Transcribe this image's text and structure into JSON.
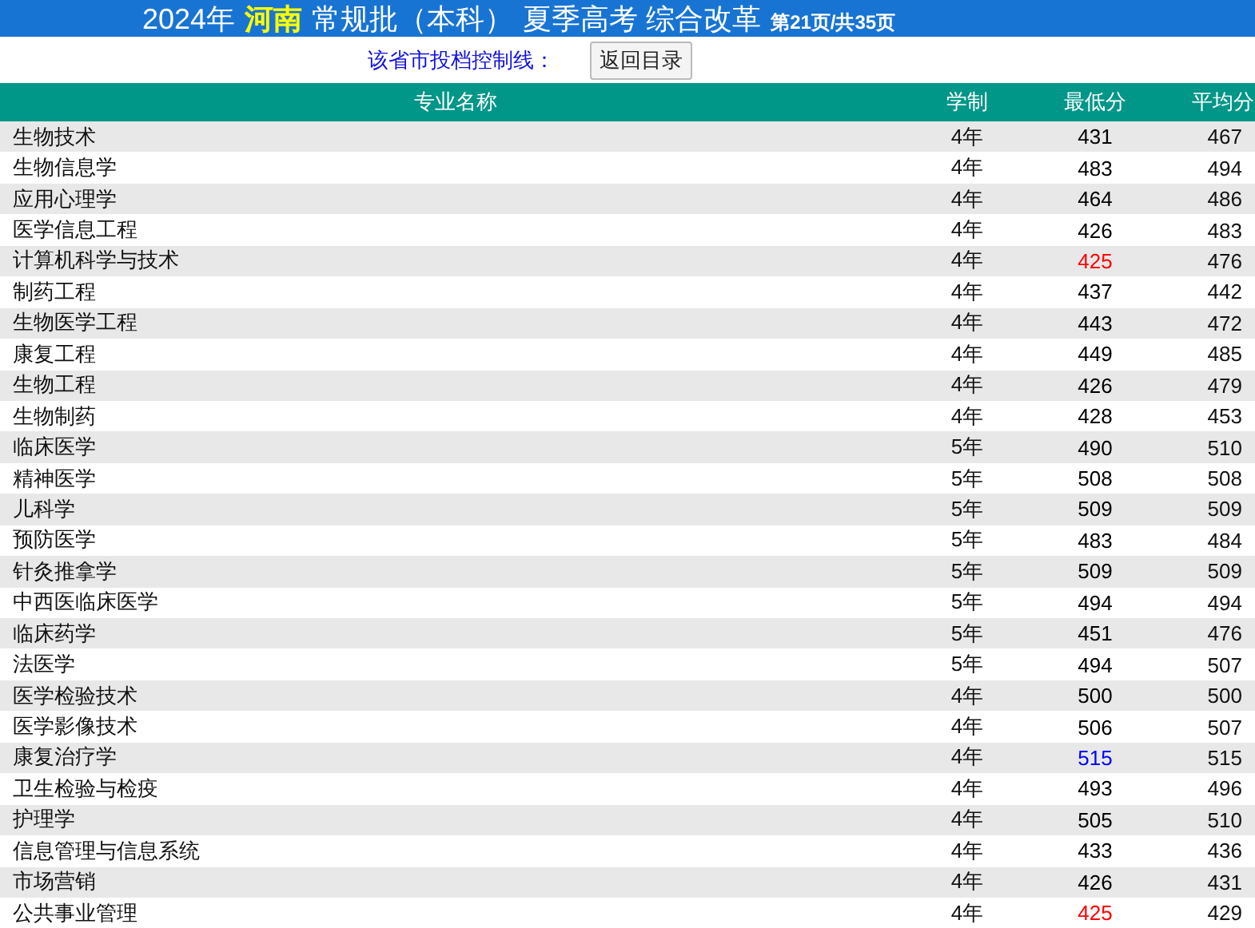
{
  "title": {
    "year": "2024年",
    "province": "河南",
    "batch": "常规批（本科）",
    "exam": "夏季高考 综合改革",
    "page": "第21页/共35页"
  },
  "control_line": {
    "label": "该省市投档控制线：",
    "button": "返回目录"
  },
  "table": {
    "columns": [
      "专业名称",
      "学制",
      "最低分",
      "平均分"
    ],
    "rows": [
      {
        "name": "生物技术",
        "years": "4年",
        "min": "431",
        "avg": "467",
        "color": "#000000"
      },
      {
        "name": "生物信息学",
        "years": "4年",
        "min": "483",
        "avg": "494",
        "color": "#000000"
      },
      {
        "name": "应用心理学",
        "years": "4年",
        "min": "464",
        "avg": "486",
        "color": "#000000"
      },
      {
        "name": "医学信息工程",
        "years": "4年",
        "min": "426",
        "avg": "483",
        "color": "#000000"
      },
      {
        "name": "计算机科学与技术",
        "years": "4年",
        "min": "425",
        "avg": "476",
        "color": "#ff0000"
      },
      {
        "name": "制药工程",
        "years": "4年",
        "min": "437",
        "avg": "442",
        "color": "#000000"
      },
      {
        "name": "生物医学工程",
        "years": "4年",
        "min": "443",
        "avg": "472",
        "color": "#000000"
      },
      {
        "name": "康复工程",
        "years": "4年",
        "min": "449",
        "avg": "485",
        "color": "#000000"
      },
      {
        "name": "生物工程",
        "years": "4年",
        "min": "426",
        "avg": "479",
        "color": "#000000"
      },
      {
        "name": "生物制药",
        "years": "4年",
        "min": "428",
        "avg": "453",
        "color": "#000000"
      },
      {
        "name": "临床医学",
        "years": "5年",
        "min": "490",
        "avg": "510",
        "color": "#000000"
      },
      {
        "name": "精神医学",
        "years": "5年",
        "min": "508",
        "avg": "508",
        "color": "#000000"
      },
      {
        "name": "儿科学",
        "years": "5年",
        "min": "509",
        "avg": "509",
        "color": "#000000"
      },
      {
        "name": "预防医学",
        "years": "5年",
        "min": "483",
        "avg": "484",
        "color": "#000000"
      },
      {
        "name": "针灸推拿学",
        "years": "5年",
        "min": "509",
        "avg": "509",
        "color": "#000000"
      },
      {
        "name": "中西医临床医学",
        "years": "5年",
        "min": "494",
        "avg": "494",
        "color": "#000000"
      },
      {
        "name": "临床药学",
        "years": "5年",
        "min": "451",
        "avg": "476",
        "color": "#000000"
      },
      {
        "name": "法医学",
        "years": "5年",
        "min": "494",
        "avg": "507",
        "color": "#000000"
      },
      {
        "name": "医学检验技术",
        "years": "4年",
        "min": "500",
        "avg": "500",
        "color": "#000000"
      },
      {
        "name": "医学影像技术",
        "years": "4年",
        "min": "506",
        "avg": "507",
        "color": "#000000"
      },
      {
        "name": "康复治疗学",
        "years": "4年",
        "min": "515",
        "avg": "515",
        "color": "#0000ff"
      },
      {
        "name": "卫生检验与检疫",
        "years": "4年",
        "min": "493",
        "avg": "496",
        "color": "#000000"
      },
      {
        "name": "护理学",
        "years": "4年",
        "min": "505",
        "avg": "510",
        "color": "#000000"
      },
      {
        "name": "信息管理与信息系统",
        "years": "4年",
        "min": "433",
        "avg": "436",
        "color": "#000000"
      },
      {
        "name": "市场营销",
        "years": "4年",
        "min": "426",
        "avg": "431",
        "color": "#000000"
      },
      {
        "name": "公共事业管理",
        "years": "4年",
        "min": "425",
        "avg": "429",
        "color": "#ff0000"
      }
    ]
  }
}
